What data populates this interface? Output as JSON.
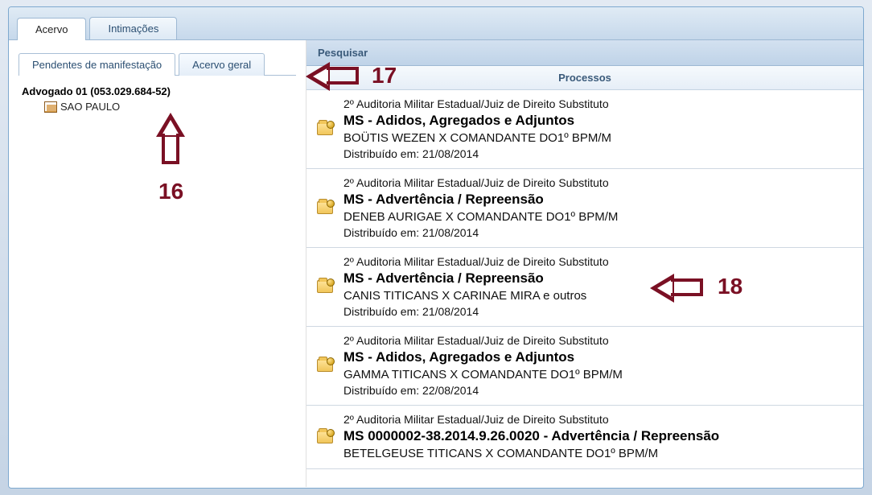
{
  "primary_tabs": {
    "active": "acervo",
    "acervo": "Acervo",
    "intimacoes": "Intimações"
  },
  "sub_tabs": {
    "active": "pendentes",
    "pendentes": "Pendentes de manifestação",
    "geral": "Acervo geral"
  },
  "search": {
    "label": "Pesquisar"
  },
  "column_header": "Processos",
  "tree": {
    "root": "Advogado 01 (053.029.684-52)",
    "child": "SAO PAULO"
  },
  "rows": [
    {
      "audit": "2º Auditoria Militar Estadual/Juiz de Direito Substituto",
      "title": "MS - Adidos, Agregados e Adjuntos",
      "parties": "BOÜTIS WEZEN X COMANDANTE DO1º BPM/M",
      "dist": "Distribuído em: 21/08/2014"
    },
    {
      "audit": "2º Auditoria Militar Estadual/Juiz de Direito Substituto",
      "title": "MS - Advertência / Repreensão",
      "parties": "DENEB AURIGAE X COMANDANTE DO1º BPM/M",
      "dist": "Distribuído em: 21/08/2014"
    },
    {
      "audit": "2º Auditoria Militar Estadual/Juiz de Direito Substituto",
      "title": "MS - Advertência / Repreensão",
      "parties": "CANIS TITICANS X CARINAE MIRA e outros",
      "dist": "Distribuído em: 21/08/2014"
    },
    {
      "audit": "2º Auditoria Militar Estadual/Juiz de Direito Substituto",
      "title": "MS - Adidos, Agregados e Adjuntos",
      "parties": "GAMMA TITICANS X COMANDANTE DO1º BPM/M",
      "dist": "Distribuído em: 22/08/2014"
    },
    {
      "audit": "2º Auditoria Militar Estadual/Juiz de Direito Substituto",
      "title": "MS 0000002-38.2014.9.26.0020 - Advertência / Repreensão",
      "parties": "BETELGEUSE TITICANS X COMANDANTE DO1º BPM/M",
      "dist": ""
    }
  ],
  "annotations": {
    "n16": "16",
    "n17": "17",
    "n18": "18"
  }
}
